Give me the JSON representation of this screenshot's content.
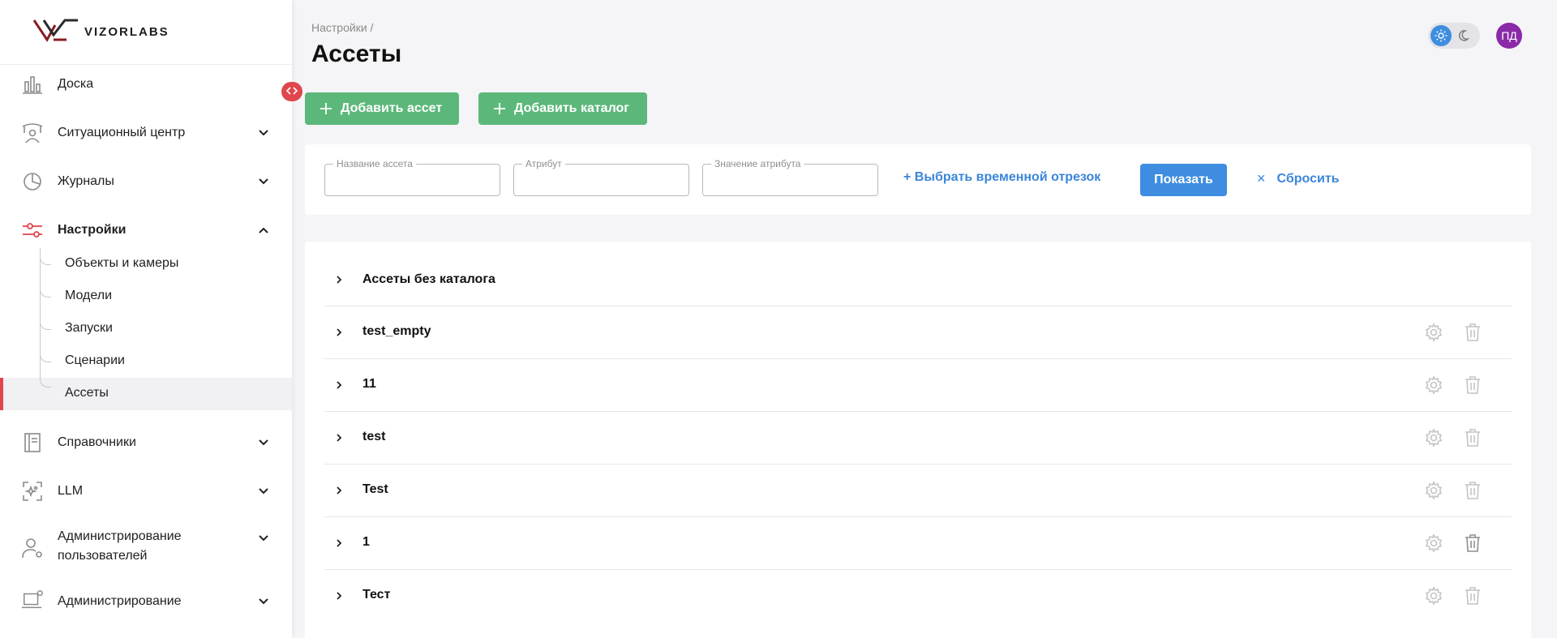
{
  "app": {
    "logo_text": "VIZORLABS"
  },
  "sidebar": {
    "items": [
      {
        "label": "Доска",
        "icon": "chart-bars-icon",
        "chevron": ""
      },
      {
        "label": "Ситуационный центр",
        "icon": "monitoring-center-icon",
        "chevron": "down"
      },
      {
        "label": "Журналы",
        "icon": "pie-chart-icon",
        "chevron": "down"
      },
      {
        "label": "Настройки",
        "icon": "sliders-icon",
        "chevron": "up",
        "active": true
      },
      {
        "label": "Справочники",
        "icon": "book-icon",
        "chevron": "down"
      },
      {
        "label": "LLM",
        "icon": "ai-sparkle-icon",
        "chevron": "down"
      },
      {
        "label_line1": "Администрирование",
        "label_line2": "пользователей",
        "icon": "user-gear-icon",
        "chevron": "down"
      },
      {
        "label": "Администрирование",
        "icon": "laptop-gear-icon",
        "chevron": "down"
      }
    ],
    "sub_items": [
      {
        "label": "Объекты и камеры"
      },
      {
        "label": "Модели"
      },
      {
        "label": "Запуски"
      },
      {
        "label": "Сценарии"
      },
      {
        "label": "Ассеты",
        "active": true
      }
    ]
  },
  "header": {
    "breadcrumb": "Настройки /",
    "title": "Ассеты",
    "avatar_initials": "ПД"
  },
  "actions": {
    "add_asset": "Добавить ассет",
    "add_catalog": "Добавить каталог"
  },
  "filters": {
    "asset_name_label": "Название ассета",
    "attribute_label": "Атрибут",
    "attribute_value_label": "Значение атрибута",
    "asset_name_value": "",
    "attribute_value": "",
    "attribute_value_value": "",
    "time_range": "+ Выбрать временной отрезок",
    "show": "Показать",
    "reset": "Сбросить",
    "reset_symbol": "×"
  },
  "catalogs": [
    {
      "name": "Ассеты без каталога",
      "actions": false
    },
    {
      "name": "test_empty",
      "actions": true
    },
    {
      "name": "11",
      "actions": true
    },
    {
      "name": "test",
      "actions": true
    },
    {
      "name": "Test",
      "actions": true
    },
    {
      "name": "1",
      "actions": true
    },
    {
      "name": "Тест",
      "actions": true
    }
  ],
  "colors": {
    "accent_red": "#e0464d",
    "green": "#5cb87a",
    "blue": "#3e8de0",
    "avatar": "#8a2aa8"
  }
}
